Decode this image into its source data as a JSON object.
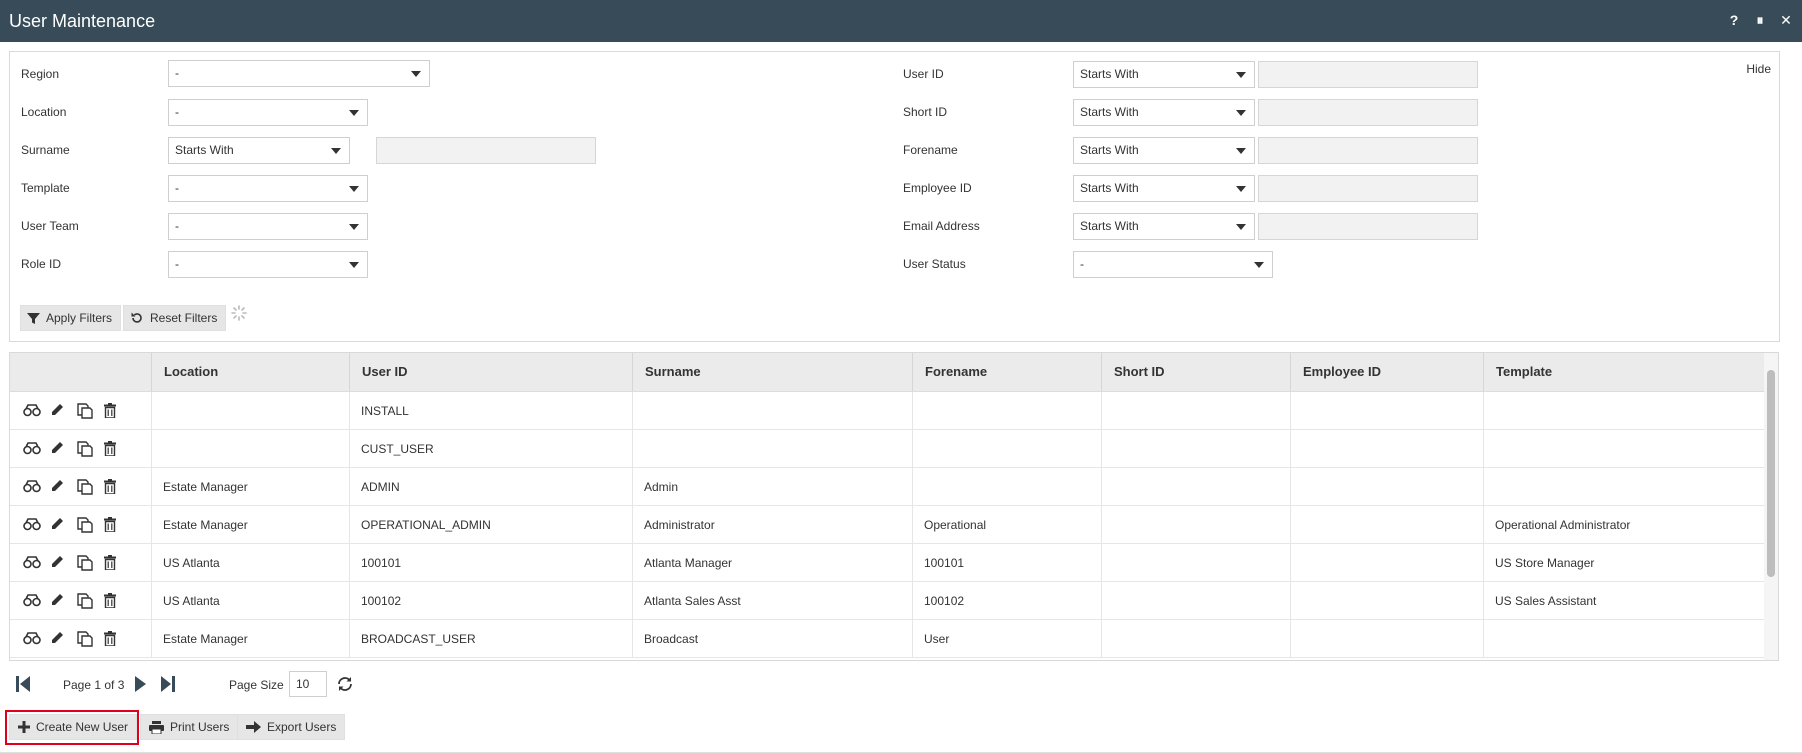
{
  "window": {
    "title": "User Maintenance",
    "buttons": [
      "?",
      "⏸",
      "✕"
    ]
  },
  "filters": {
    "hide_label": "Hide",
    "left": [
      {
        "label": "Region",
        "select": "-"
      },
      {
        "label": "Location",
        "select": "-"
      },
      {
        "label": "Surname",
        "select": "Starts With",
        "input": ""
      },
      {
        "label": "Template",
        "select": "-"
      },
      {
        "label": "User Team",
        "select": "-"
      },
      {
        "label": "Role ID",
        "select": "-"
      }
    ],
    "right": [
      {
        "label": "User ID",
        "select": "Starts With",
        "input": ""
      },
      {
        "label": "Short ID",
        "select": "Starts With",
        "input": ""
      },
      {
        "label": "Forename",
        "select": "Starts With",
        "input": ""
      },
      {
        "label": "Employee ID",
        "select": "Starts With",
        "input": ""
      },
      {
        "label": "Email Address",
        "select": "Starts With",
        "input": ""
      },
      {
        "label": "User Status",
        "select": "-"
      }
    ],
    "apply_label": "Apply Filters",
    "reset_label": "Reset Filters"
  },
  "table": {
    "columns": [
      "",
      "Location",
      "User ID",
      "Surname",
      "Forename",
      "Short ID",
      "Employee ID",
      "Template"
    ],
    "rows": [
      [
        "",
        "INSTALL",
        "",
        "",
        "",
        "",
        ""
      ],
      [
        "",
        "CUST_USER",
        "",
        "",
        "",
        "",
        ""
      ],
      [
        "Estate Manager",
        "ADMIN",
        "Admin",
        "",
        "",
        "",
        ""
      ],
      [
        "Estate Manager",
        "OPERATIONAL_ADMIN",
        "Administrator",
        "Operational",
        "",
        "",
        "Operational Administrator"
      ],
      [
        "US Atlanta",
        "100101",
        "Atlanta Manager",
        "100101",
        "",
        "",
        "US Store Manager"
      ],
      [
        "US Atlanta",
        "100102",
        "Atlanta Sales Asst",
        "100102",
        "",
        "",
        "US Sales Assistant"
      ],
      [
        "Estate Manager",
        "BROADCAST_USER",
        "Broadcast",
        "User",
        "",
        "",
        ""
      ]
    ]
  },
  "pager": {
    "page_text": "Page 1 of 3",
    "page_size_label": "Page Size",
    "page_size": "10"
  },
  "actions": {
    "create": "Create New User",
    "print": "Print Users",
    "export": "Export Users"
  },
  "colors": {
    "titlebar": "#384b58",
    "highlight": "#e0001b"
  }
}
